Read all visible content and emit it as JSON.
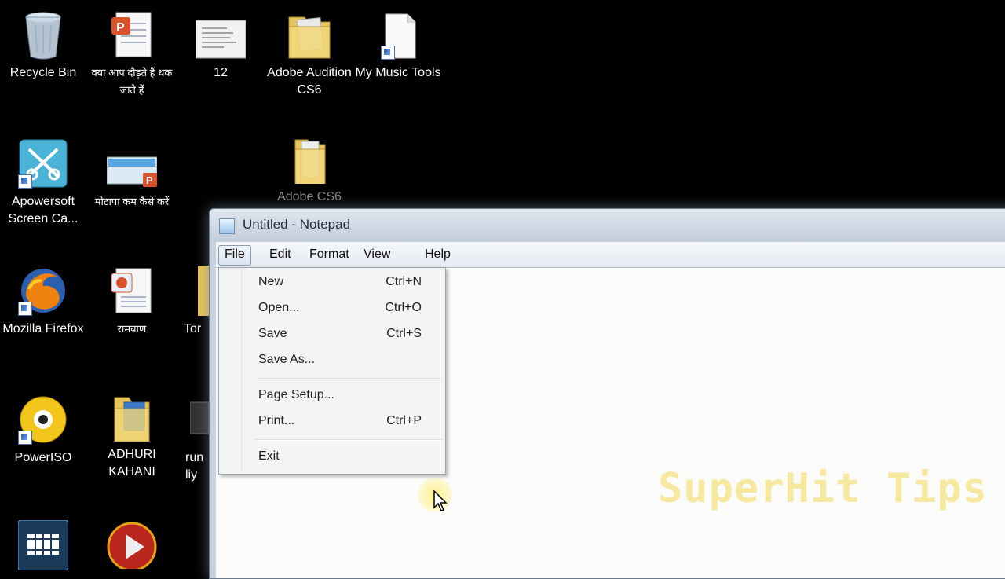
{
  "desktop": {
    "icons": [
      {
        "label": "Recycle Bin"
      },
      {
        "label": "क्या आप दौड़ते हैं थक जाते हैं"
      },
      {
        "label": "12"
      },
      {
        "label": "Adobe Audition CS6"
      },
      {
        "label": "My Music Tools"
      },
      {
        "label": "Apowersoft Screen Ca..."
      },
      {
        "label": "मोटापा कम कैसे करें"
      },
      {
        "label": "Adobe CS6"
      },
      {
        "label": "Mozilla Firefox"
      },
      {
        "label": "रामबाण"
      },
      {
        "label": "Tor"
      },
      {
        "label": "PowerISO"
      },
      {
        "label": "ADHURI KAHANI"
      },
      {
        "label": "run liy"
      }
    ]
  },
  "notepad": {
    "title": "Untitled - Notepad",
    "menu": [
      {
        "label": "File"
      },
      {
        "label": "Edit"
      },
      {
        "label": "Format"
      },
      {
        "label": "View"
      },
      {
        "label": "Help"
      }
    ],
    "file_menu": [
      {
        "label": "New",
        "shortcut": "Ctrl+N"
      },
      {
        "label": "Open...",
        "shortcut": "Ctrl+O"
      },
      {
        "label": "Save",
        "shortcut": "Ctrl+S"
      },
      {
        "label": "Save As...",
        "shortcut": ""
      },
      {
        "label": "Page Setup...",
        "shortcut": ""
      },
      {
        "label": "Print...",
        "shortcut": "Ctrl+P"
      },
      {
        "label": "Exit",
        "shortcut": ""
      }
    ]
  },
  "watermark": "SuperHit Tips",
  "colors": {
    "desktop_bg": "#000000",
    "watermark": "#f5e182"
  }
}
